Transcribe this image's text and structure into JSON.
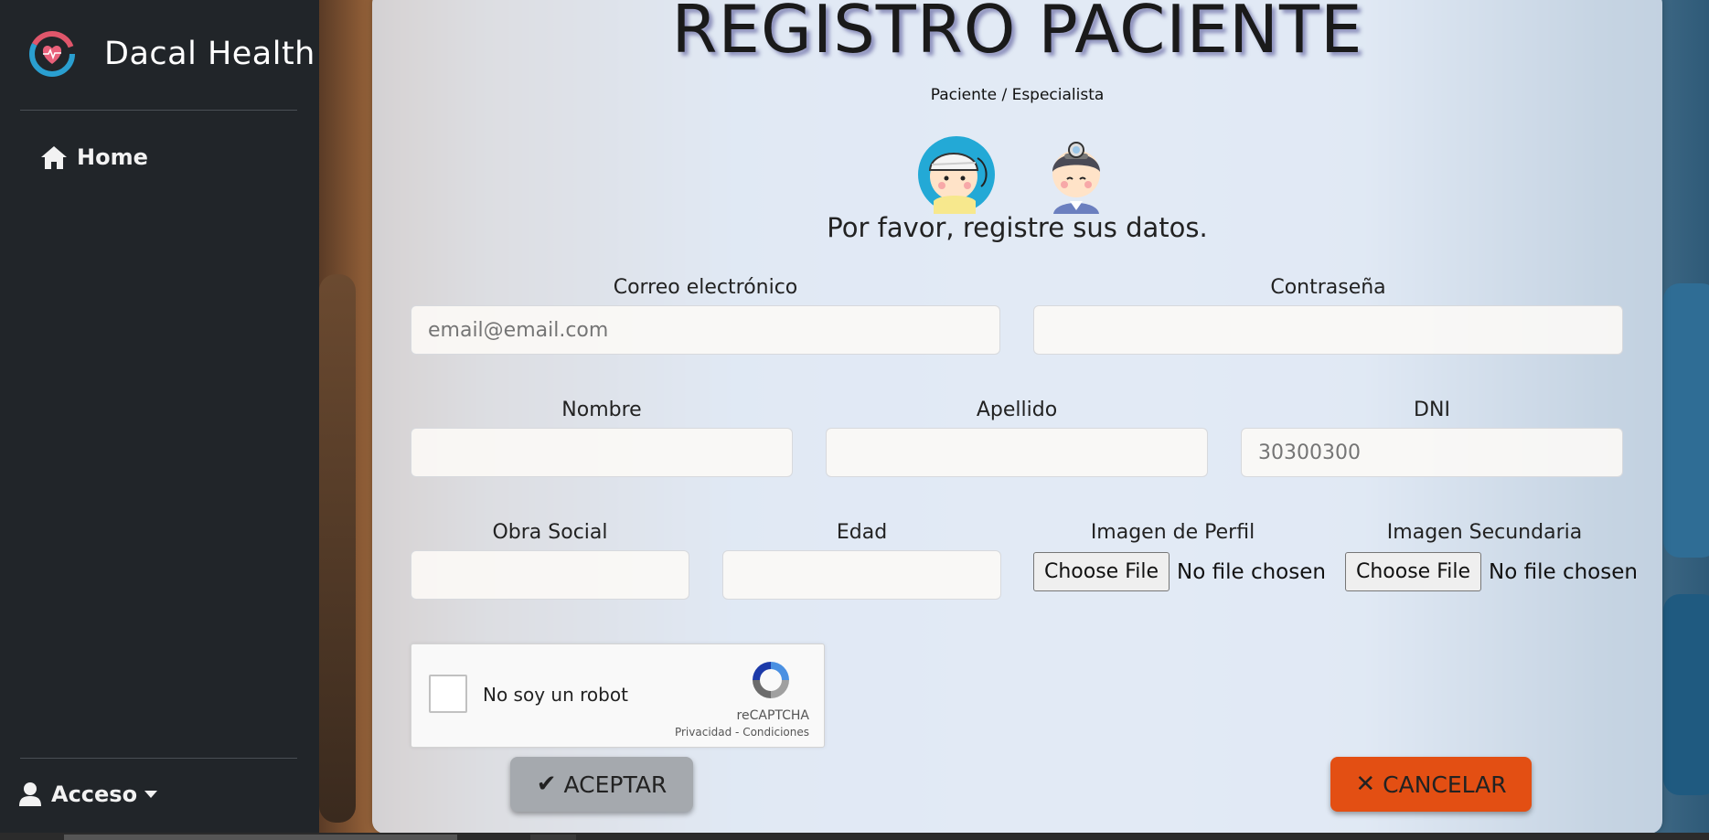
{
  "app": {
    "name": "Dacal Health"
  },
  "sidebar": {
    "home_label": "Home",
    "access_label": "Acceso"
  },
  "form": {
    "title": "REGISTRO PACIENTE",
    "subtitle": "Paciente / Especialista",
    "prompt": "Por favor, registre sus datos.",
    "fields": {
      "email": {
        "label": "Correo electrónico",
        "placeholder": "email@email.com",
        "value": ""
      },
      "password": {
        "label": "Contraseña",
        "value": ""
      },
      "nombre": {
        "label": "Nombre",
        "value": ""
      },
      "apellido": {
        "label": "Apellido",
        "value": ""
      },
      "dni": {
        "label": "DNI",
        "placeholder": "30300300",
        "value": ""
      },
      "obra_social": {
        "label": "Obra Social",
        "value": ""
      },
      "edad": {
        "label": "Edad",
        "value": ""
      },
      "imagen_perfil": {
        "label": "Imagen de Perfil",
        "button": "Choose File",
        "status": "No file chosen"
      },
      "imagen_secundaria": {
        "label": "Imagen Secundaria",
        "button": "Choose File",
        "status": "No file chosen"
      }
    },
    "captcha": {
      "label": "No soy un robot",
      "brand": "reCAPTCHA",
      "links": "Privacidad - Condiciones"
    },
    "accept_label": "ACEPTAR",
    "cancel_label": "CANCELAR"
  },
  "colors": {
    "sidebar_bg": "#212529",
    "accept_bg": "#a5a9ae",
    "cancel_bg": "#e34f13"
  }
}
